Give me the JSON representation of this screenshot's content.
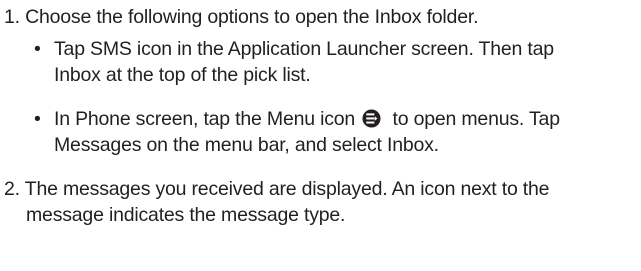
{
  "steps": [
    {
      "number": "1.",
      "text": "Choose the following options to open the Inbox folder.",
      "bullets": [
        {
          "line1": "Tap SMS icon in the Application Launcher screen. Then tap",
          "line2": "Inbox at the top of the pick list."
        },
        {
          "line1_before_icon": "In Phone screen, tap the Menu icon",
          "icon": "menu-icon",
          "line1_after_icon": "to open menus. Tap",
          "line2": "Messages on the menu bar, and select Inbox."
        }
      ]
    },
    {
      "number": "2.",
      "line1": "The messages you received are displayed. An icon next to the",
      "line2": "message indicates the message type."
    }
  ],
  "bullet_glyph": "•"
}
